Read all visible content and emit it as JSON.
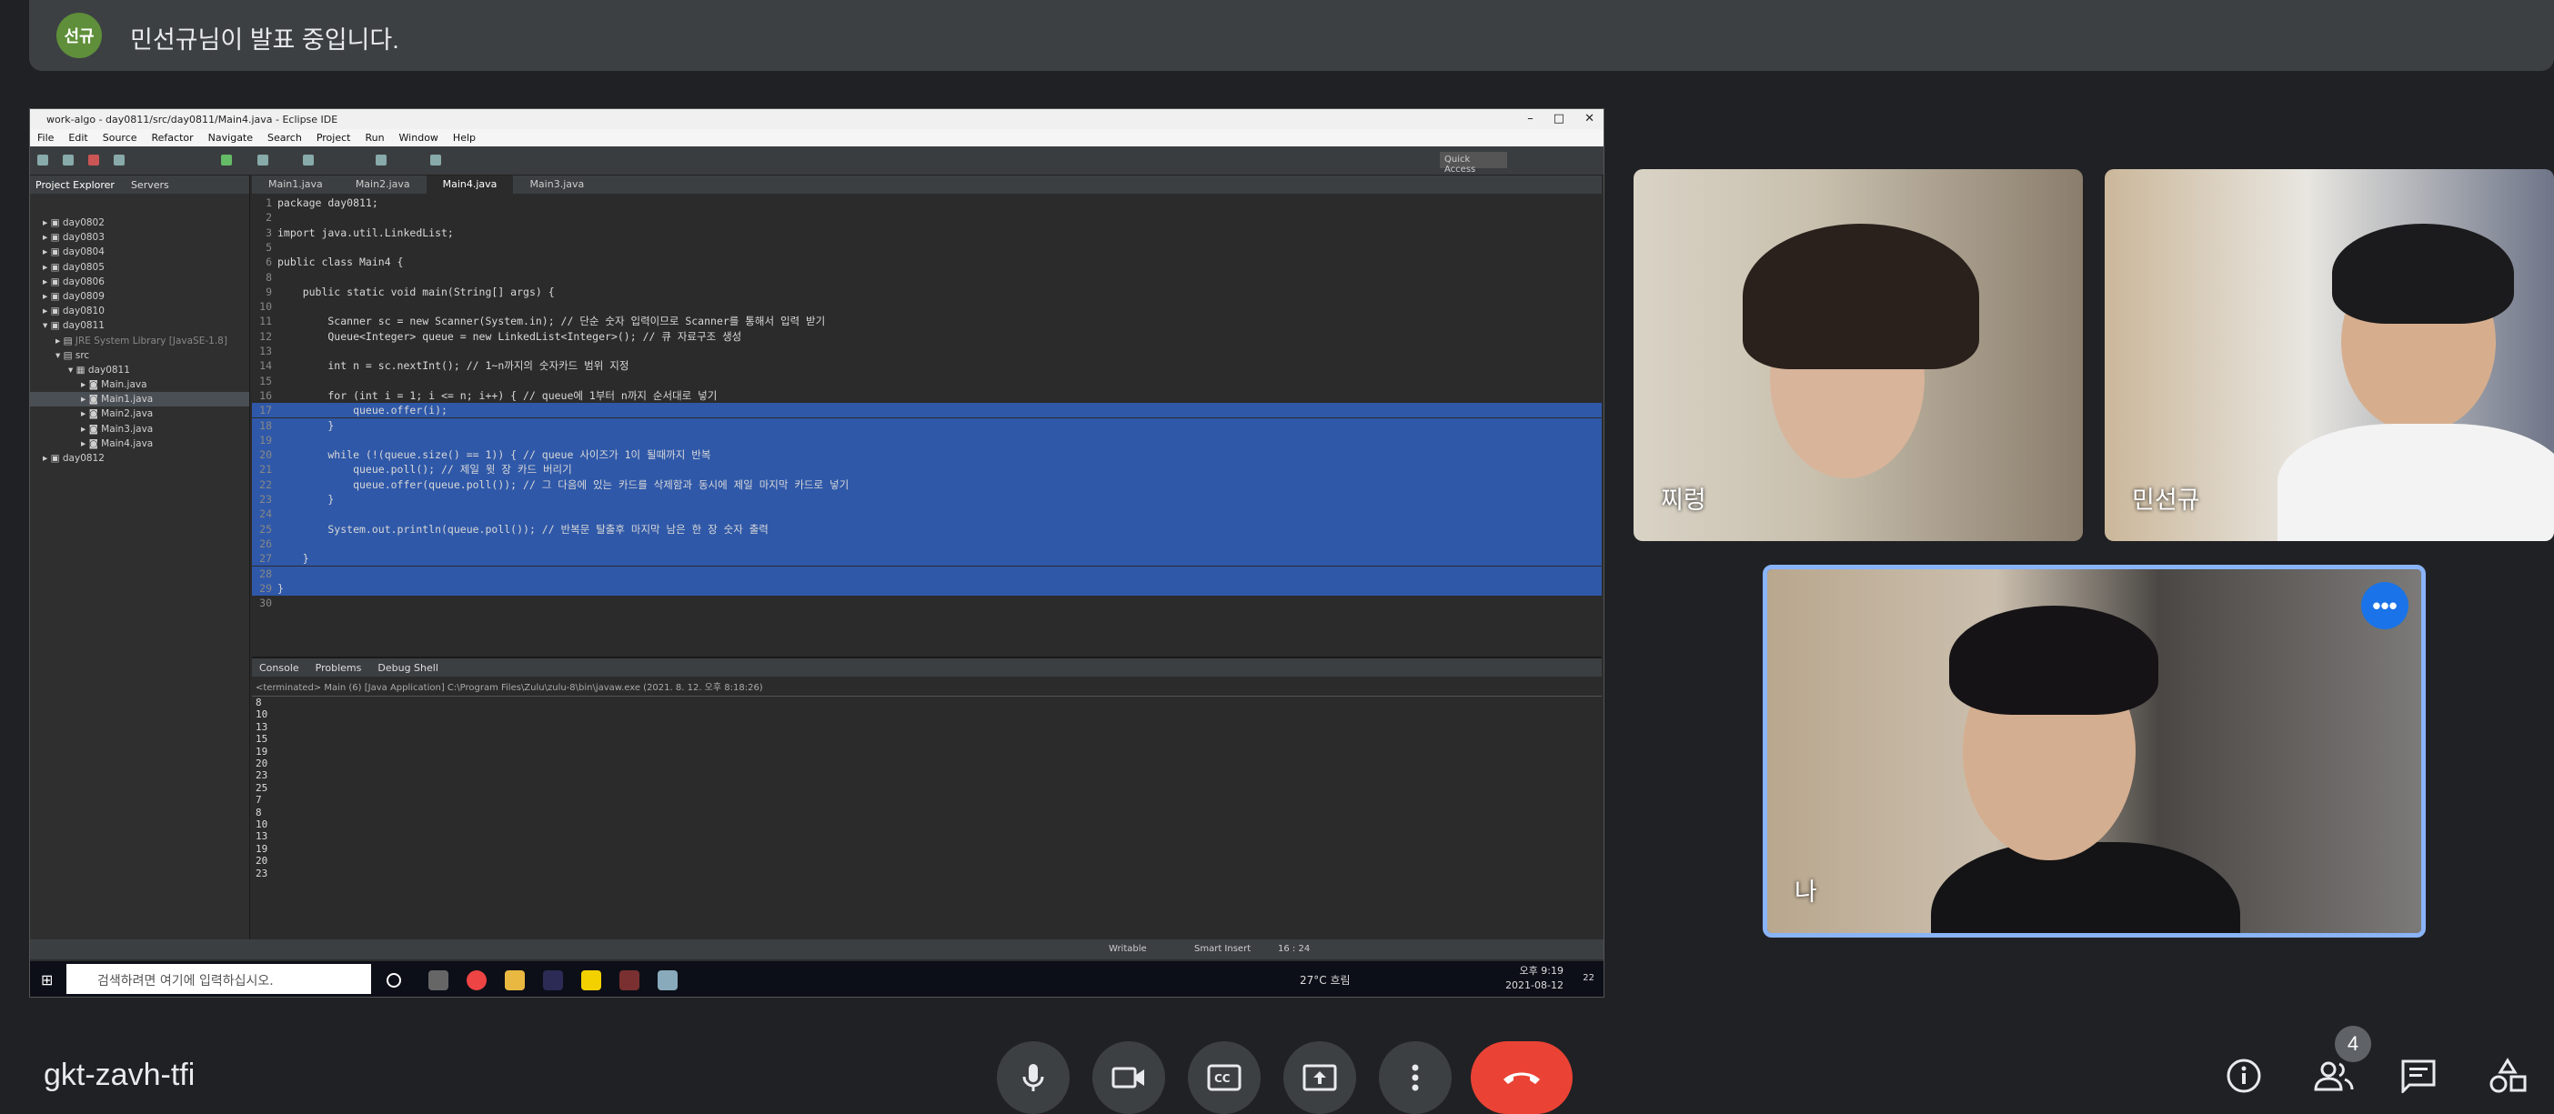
{
  "banner": {
    "avatar_text": "선규",
    "text": "민선규님이 발표 중입니다."
  },
  "eclipse": {
    "title": "work-algo - day0811/src/day0811/Main4.java - Eclipse IDE",
    "window_buttons": [
      "–",
      "□",
      "✕"
    ],
    "menu": [
      "File",
      "Edit",
      "Source",
      "Refactor",
      "Navigate",
      "Search",
      "Project",
      "Run",
      "Window",
      "Help"
    ],
    "quick_access": "Quick Access",
    "explorer_tabs": [
      "Project Explorer",
      "Servers"
    ],
    "tree": [
      "day0802",
      "day0803",
      "day0804",
      "day0805",
      "day0806",
      "day0809",
      "day0810",
      "day0811",
      "JRE System Library [JavaSE-1.8]",
      "src",
      "day0811",
      "Main.java",
      "Main1.java",
      "Main2.java",
      "Main3.java",
      "Main4.java",
      "day0812"
    ],
    "editor_tabs": [
      "Main1.java",
      "Main2.java",
      "Main4.java",
      "Main3.java"
    ],
    "code": [
      {
        "n": "1",
        "t": "package day0811;"
      },
      {
        "n": "2",
        "t": ""
      },
      {
        "n": "3",
        "t": "import java.util.LinkedList;"
      },
      {
        "n": "5",
        "t": ""
      },
      {
        "n": "6",
        "t": "public class Main4 {"
      },
      {
        "n": "8",
        "t": ""
      },
      {
        "n": "9",
        "t": "    public static void main(String[] args) {"
      },
      {
        "n": "10",
        "t": ""
      },
      {
        "n": "11",
        "t": "        Scanner sc = new Scanner(System.in); // 단순 숫자 입력이므로 Scanner를 통해서 입력 받기"
      },
      {
        "n": "12",
        "t": "        Queue<Integer> queue = new LinkedList<Integer>(); // 큐 자료구조 생성"
      },
      {
        "n": "13",
        "t": ""
      },
      {
        "n": "14",
        "t": "        int n = sc.nextInt(); // 1~n까지의 숫자카드 범위 지정"
      },
      {
        "n": "15",
        "t": ""
      },
      {
        "n": "16",
        "t": "        for (int i = 1; i <= n; i++) { // queue에 1부터 n까지 순서대로 넣기"
      },
      {
        "n": "17",
        "t": "            queue.offer(i);"
      },
      {
        "n": "18",
        "t": "        }"
      },
      {
        "n": "19",
        "t": ""
      },
      {
        "n": "20",
        "t": "        while (!(queue.size() == 1)) { // queue 사이즈가 1이 될때까지 반복"
      },
      {
        "n": "21",
        "t": "            queue.poll(); // 제일 윗 장 카드 버리기"
      },
      {
        "n": "22",
        "t": "            queue.offer(queue.poll()); // 그 다음에 있는 카드를 삭제함과 동시에 제일 마지막 카드로 넣기"
      },
      {
        "n": "23",
        "t": "        }"
      },
      {
        "n": "24",
        "t": ""
      },
      {
        "n": "25",
        "t": "        System.out.println(queue.poll()); // 반복문 탈출후 마지막 남은 한 장 숫자 출력"
      },
      {
        "n": "26",
        "t": ""
      },
      {
        "n": "27",
        "t": "    }"
      },
      {
        "n": "28",
        "t": ""
      },
      {
        "n": "29",
        "t": "}"
      },
      {
        "n": "30",
        "t": ""
      }
    ],
    "console_tabs": [
      "Console",
      "Problems",
      "Debug Shell"
    ],
    "console_head": "<terminated> Main (6) [Java Application] C:\\Program Files\\Zulu\\zulu-8\\bin\\javaw.exe (2021. 8. 12. 오후 8:18:26)",
    "console_out": [
      "8",
      "10",
      "13",
      "15",
      "19",
      "20",
      "23",
      "25",
      "7",
      "8",
      "10",
      "13",
      "19",
      "20",
      "23"
    ],
    "status": {
      "writable": "Writable",
      "insert": "Smart Insert",
      "pos": "16 : 24"
    },
    "taskbar": {
      "search": "검색하려면 여기에 입력하십시오.",
      "weather": "27°C 흐림",
      "time": "오후 9:19",
      "date": "2021-08-12",
      "notif": "22"
    }
  },
  "tiles": [
    {
      "name": "찌렁"
    },
    {
      "name": "민선규"
    },
    {
      "name": "나"
    }
  ],
  "meeting_code": "gkt-zavh-tfi",
  "participants_count": "4",
  "colors": {
    "end_call": "#ea4335",
    "highlight": "#2f58a8",
    "self_border": "#8ab4f8"
  }
}
